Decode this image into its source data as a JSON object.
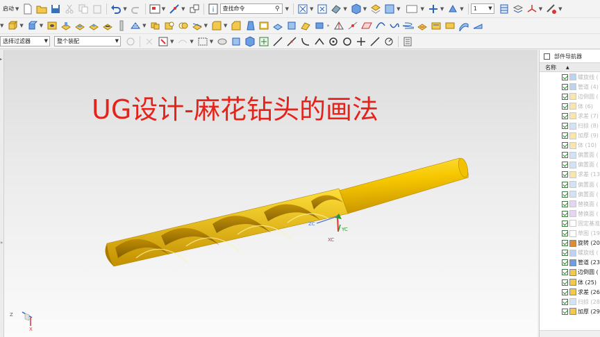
{
  "toolbar_top": {
    "start_label": "启动",
    "search_placeholder": "查找命令",
    "layer_value": "1"
  },
  "selection_bar": {
    "filter_value": "选择过滤器",
    "scope_value": "整个装配"
  },
  "viewport": {
    "title": "UG设计-麻花钻头的画法",
    "csys_labels": {
      "zc": "ZC",
      "xc": "XC",
      "yc": "YC"
    },
    "triad_labels": {
      "z": "Z",
      "x": "X"
    }
  },
  "part_navigator": {
    "title": "部件导航器",
    "column_name": "名称",
    "nodes": [
      {
        "label": "螺旋线 (",
        "icon": "helix-icon",
        "dim": true
      },
      {
        "label": "管道 (4)",
        "icon": "tube-icon",
        "dim": true
      },
      {
        "label": "边倒圆 (",
        "icon": "edge-blend-icon",
        "dim": true
      },
      {
        "label": "体 (6)",
        "icon": "body-icon",
        "dim": true
      },
      {
        "label": "求差 (7)",
        "icon": "subtract-icon",
        "dim": true
      },
      {
        "label": "扫掠 (8)",
        "icon": "swept-icon",
        "dim": true
      },
      {
        "label": "加厚 (9)",
        "icon": "thicken-icon",
        "dim": true
      },
      {
        "label": "体 (10)",
        "icon": "body-icon",
        "dim": true
      },
      {
        "label": "偏置面 (",
        "icon": "offset-face-icon",
        "dim": true
      },
      {
        "label": "偏置面 (",
        "icon": "offset-face-icon",
        "dim": true
      },
      {
        "label": "求差 (13",
        "icon": "subtract-icon",
        "dim": true
      },
      {
        "label": "偏置面 (",
        "icon": "offset-face-icon",
        "dim": true
      },
      {
        "label": "偏置面 (",
        "icon": "offset-face-icon",
        "dim": true
      },
      {
        "label": "替换面 (",
        "icon": "replace-face-icon",
        "dim": true
      },
      {
        "label": "替换面 (",
        "icon": "replace-face-icon",
        "dim": true
      },
      {
        "label": "固定基准",
        "icon": "datum-icon",
        "dim": true
      },
      {
        "label": "草图 (19",
        "icon": "sketch-icon",
        "dim": true
      },
      {
        "label": "旋转 (20",
        "icon": "revolve-icon",
        "dim": false
      },
      {
        "label": "螺旋线 (",
        "icon": "helix-icon",
        "dim": true
      },
      {
        "label": "管道 (23",
        "icon": "tube-icon",
        "dim": false
      },
      {
        "label": "边倒圆 (",
        "icon": "edge-blend-icon",
        "dim": false
      },
      {
        "label": "体 (25)",
        "icon": "body-icon",
        "dim": false
      },
      {
        "label": "求差 (26",
        "icon": "subtract-icon",
        "dim": false
      },
      {
        "label": "扫掠 (28",
        "icon": "swept-icon",
        "dim": true
      },
      {
        "label": "加厚 (29",
        "icon": "thicken-icon",
        "dim": false
      }
    ]
  },
  "colors": {
    "title_red": "#e5231b",
    "drill_yellow": "#f4c200",
    "navigator_check": "#1a8a1a"
  }
}
